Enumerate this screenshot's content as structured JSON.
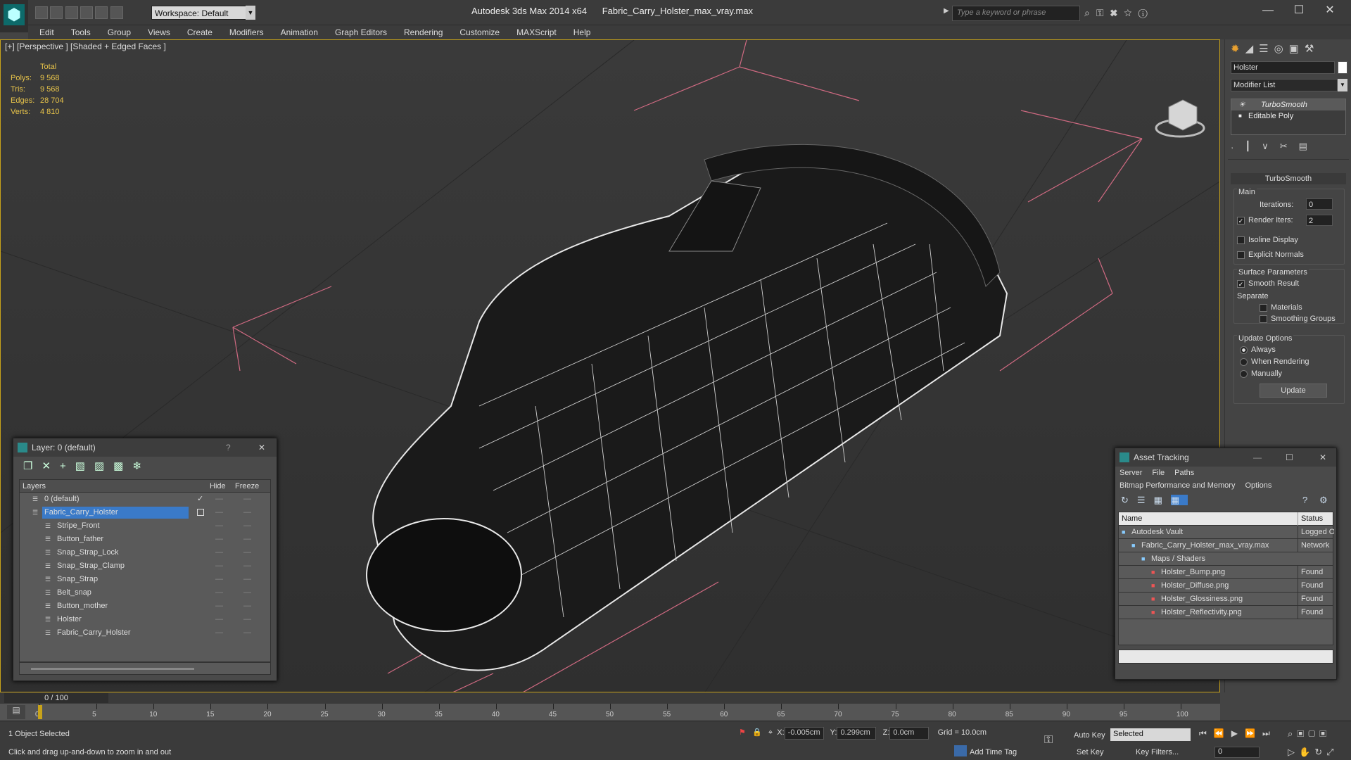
{
  "app": {
    "title": "Autodesk 3ds Max  2014 x64",
    "file": "Fabric_Carry_Holster_max_vray.max",
    "workspace": "Workspace: Default",
    "search_placeholder": "Type a keyword or phrase"
  },
  "menu": [
    "Edit",
    "Tools",
    "Group",
    "Views",
    "Create",
    "Modifiers",
    "Animation",
    "Graph Editors",
    "Rendering",
    "Customize",
    "MAXScript",
    "Help"
  ],
  "viewport": {
    "label": "[+] [Perspective ] [Shaded + Edged Faces ]",
    "stats": {
      "header": "Total",
      "rows": [
        {
          "k": "Polys:",
          "v": "9 568"
        },
        {
          "k": "Tris:",
          "v": "9 568"
        },
        {
          "k": "Edges:",
          "v": "28 704"
        },
        {
          "k": "Verts:",
          "v": "4 810"
        }
      ]
    }
  },
  "command_panel": {
    "object_name": "Holster",
    "modifier_list": "Modifier List",
    "stack": [
      "TurboSmooth",
      "Editable Poly"
    ],
    "rollout": "TurboSmooth",
    "main_label": "Main",
    "iterations_label": "Iterations:",
    "iterations": "0",
    "render_iters_label": "Render Iters:",
    "render_iters": "2",
    "isoline": "Isoline Display",
    "explicit": "Explicit Normals",
    "surface_params": "Surface Parameters",
    "smooth_result": "Smooth Result",
    "separate": "Separate",
    "materials": "Materials",
    "smoothing_groups": "Smoothing Groups",
    "update_options": "Update Options",
    "always": "Always",
    "when_rendering": "When Rendering",
    "manually": "Manually",
    "update_btn": "Update"
  },
  "layer_window": {
    "title": "Layer: 0 (default)",
    "help": "?",
    "col_layers": "Layers",
    "col_hide": "Hide",
    "col_freeze": "Freeze",
    "layers": [
      {
        "name": "0 (default)",
        "indent": 1
      },
      {
        "name": "Fabric_Carry_Holster",
        "indent": 1,
        "selected": true
      },
      {
        "name": "Stripe_Front",
        "indent": 2
      },
      {
        "name": "Button_father",
        "indent": 2
      },
      {
        "name": "Snap_Strap_Lock",
        "indent": 2
      },
      {
        "name": "Snap_Strap_Clamp",
        "indent": 2
      },
      {
        "name": "Snap_Strap",
        "indent": 2
      },
      {
        "name": "Belt_snap",
        "indent": 2
      },
      {
        "name": "Button_mother",
        "indent": 2
      },
      {
        "name": "Holster",
        "indent": 2
      },
      {
        "name": "Fabric_Carry_Holster",
        "indent": 2
      }
    ]
  },
  "asset_window": {
    "title": "Asset Tracking",
    "menu1": [
      "Server",
      "File",
      "Paths"
    ],
    "menu2": [
      "Bitmap Performance and Memory",
      "Options"
    ],
    "col_name": "Name",
    "col_status": "Status",
    "rows": [
      {
        "name": "Autodesk Vault",
        "status": "Logged O",
        "indent": 1
      },
      {
        "name": "Fabric_Carry_Holster_max_vray.max",
        "status": "Network",
        "indent": 2
      },
      {
        "name": "Maps / Shaders",
        "status": "",
        "indent": 3
      },
      {
        "name": "Holster_Bump.png",
        "status": "Found",
        "indent": 4
      },
      {
        "name": "Holster_Diffuse.png",
        "status": "Found",
        "indent": 4
      },
      {
        "name": "Holster_Glossiness.png",
        "status": "Found",
        "indent": 4
      },
      {
        "name": "Holster_Reflectivity.png",
        "status": "Found",
        "indent": 4
      }
    ]
  },
  "timeline": {
    "frame": "0 / 100",
    "ticks": [
      "0",
      "5",
      "10",
      "15",
      "20",
      "25",
      "30",
      "35",
      "40",
      "45",
      "50",
      "55",
      "60",
      "65",
      "70",
      "75",
      "80",
      "85",
      "90",
      "95",
      "100"
    ]
  },
  "status": {
    "selected": "1 Object Selected",
    "hint": "Click and drag up-and-down to zoom in and out",
    "x_label": "X:",
    "x": "-0.005cm",
    "y_label": "Y:",
    "y": "0.299cm",
    "z_label": "Z:",
    "z": "0.0cm",
    "grid": "Grid = 10.0cm",
    "auto_key": "Auto Key",
    "set_key": "Set Key",
    "key_mode": "Selected",
    "key_filters": "Key Filters...",
    "add_time_tag": "Add Time Tag",
    "frame_field": "0"
  }
}
